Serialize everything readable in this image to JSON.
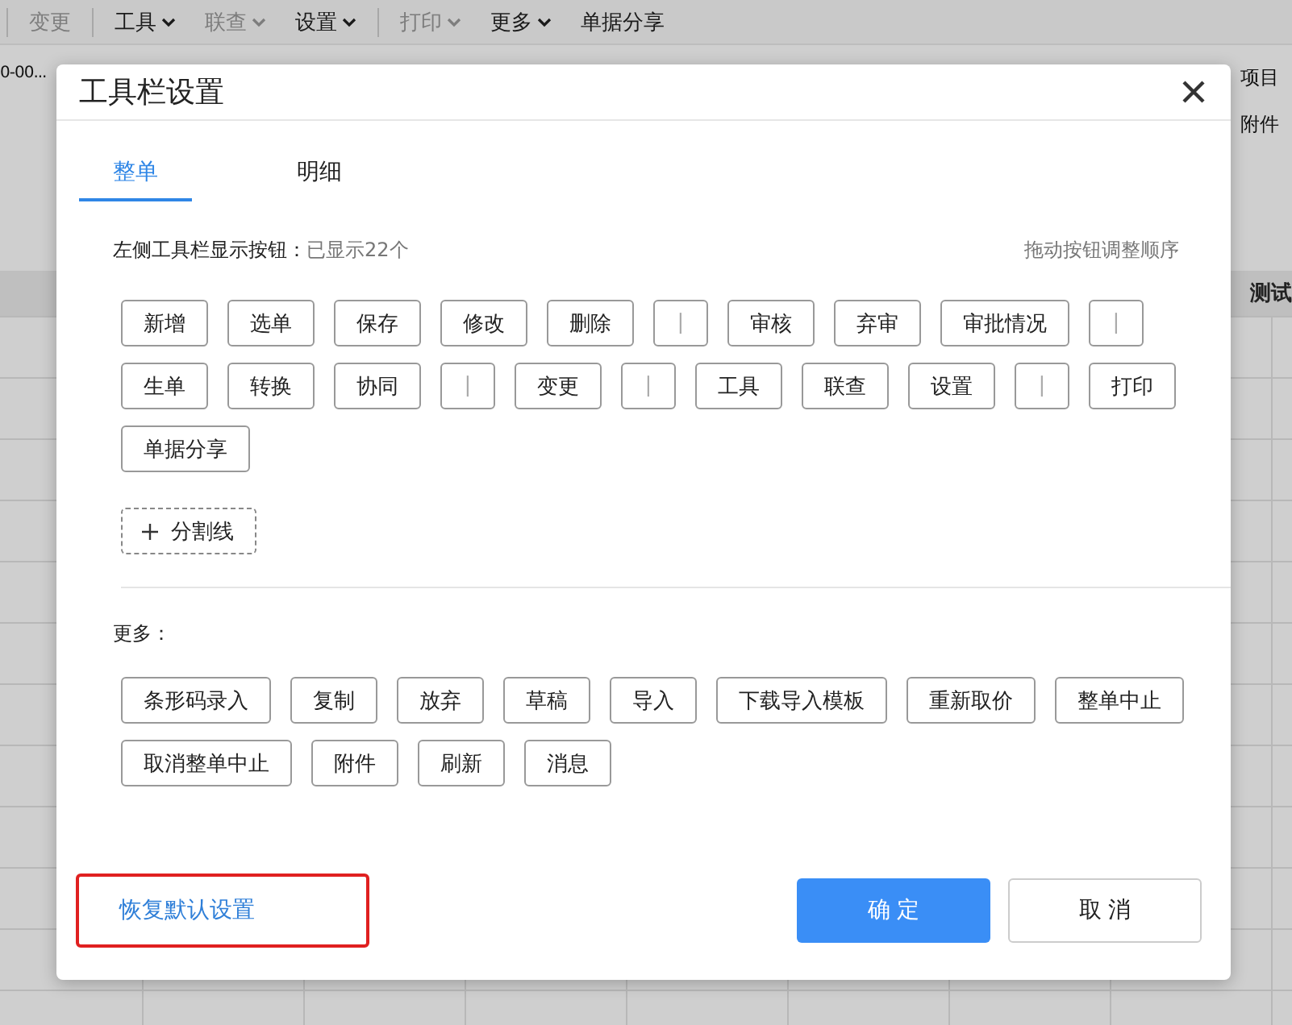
{
  "menu_bar": {
    "items": [
      {
        "label": "变更",
        "disabled": true,
        "dropdown": false,
        "separator_before": true
      },
      {
        "label": "工具",
        "disabled": false,
        "dropdown": true,
        "separator_before": true
      },
      {
        "label": "联查",
        "disabled": true,
        "dropdown": true,
        "separator_before": false
      },
      {
        "label": "设置",
        "disabled": false,
        "dropdown": true,
        "separator_before": false
      },
      {
        "label": "打印",
        "disabled": true,
        "dropdown": true,
        "separator_before": true
      },
      {
        "label": "更多",
        "disabled": false,
        "dropdown": true,
        "separator_before": false
      },
      {
        "label": "单据分享",
        "disabled": false,
        "dropdown": false,
        "separator_before": false
      }
    ]
  },
  "background": {
    "field_value": "0-00...",
    "side_labels": [
      "项目",
      "附件"
    ],
    "table_headers": [
      "测试"
    ]
  },
  "dialog": {
    "title": "工具栏设置",
    "tabs": [
      {
        "label": "整单",
        "selected": true
      },
      {
        "label": "明细",
        "selected": false
      }
    ],
    "toolbar_label": "左侧工具栏显示按钮：",
    "toolbar_count": "已显示22个",
    "hint": "拖动按钮调整顺序",
    "toolbar_buttons": [
      {
        "kind": "button",
        "label": "新增"
      },
      {
        "kind": "button",
        "label": "选单"
      },
      {
        "kind": "button",
        "label": "保存"
      },
      {
        "kind": "button",
        "label": "修改"
      },
      {
        "kind": "button",
        "label": "删除"
      },
      {
        "kind": "separator",
        "label": "|"
      },
      {
        "kind": "button",
        "label": "审核"
      },
      {
        "kind": "button",
        "label": "弃审"
      },
      {
        "kind": "button",
        "label": "审批情况"
      },
      {
        "kind": "separator",
        "label": "|"
      },
      {
        "kind": "button",
        "label": "生单"
      },
      {
        "kind": "button",
        "label": "转换"
      },
      {
        "kind": "button",
        "label": "协同"
      },
      {
        "kind": "separator",
        "label": "|"
      },
      {
        "kind": "button",
        "label": "变更"
      },
      {
        "kind": "separator",
        "label": "|"
      },
      {
        "kind": "button",
        "label": "工具"
      },
      {
        "kind": "button",
        "label": "联查"
      },
      {
        "kind": "button",
        "label": "设置"
      },
      {
        "kind": "separator",
        "label": "|"
      },
      {
        "kind": "button",
        "label": "打印"
      },
      {
        "kind": "button",
        "label": "单据分享"
      }
    ],
    "add_separator": "分割线",
    "more_label": "更多：",
    "more_buttons": [
      "条形码录入",
      "复制",
      "放弃",
      "草稿",
      "导入",
      "下载导入模板",
      "重新取价",
      "整单中止",
      "取消整单中止",
      "附件",
      "刷新",
      "消息"
    ],
    "restore": {
      "label": "恢复默认设置",
      "highlighted": true
    },
    "ok": "确 定",
    "cancel": "取 消"
  }
}
